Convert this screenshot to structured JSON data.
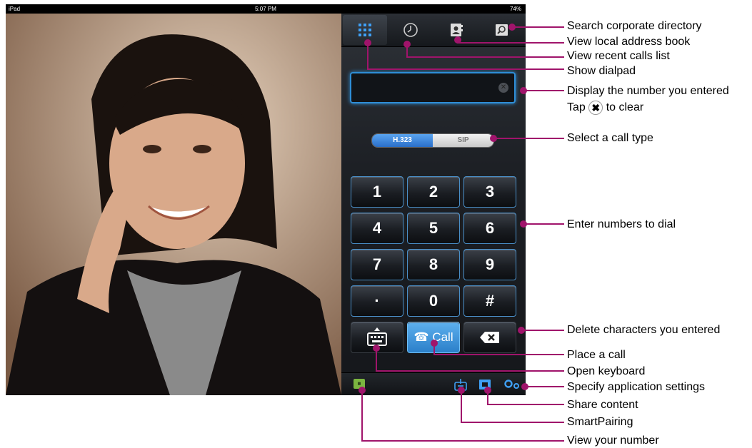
{
  "statusbar": {
    "device": "iPad",
    "time": "5:07 PM",
    "battery": "74%"
  },
  "tabs": [
    {
      "icon": "dialpad-icon"
    },
    {
      "icon": "recent-calls-icon"
    },
    {
      "icon": "address-book-icon"
    },
    {
      "icon": "search-directory-icon"
    }
  ],
  "call_type": {
    "options": [
      "H.323",
      "SIP"
    ],
    "selected": "H.323"
  },
  "keypad": [
    "1",
    "2",
    "3",
    "4",
    "5",
    "6",
    "7",
    "8",
    "9",
    "·",
    "0",
    "#"
  ],
  "call_button": {
    "label": "Call"
  },
  "annotations": {
    "search": "Search corporate directory",
    "address_book": "View local address book",
    "recent": "View recent calls list",
    "dialpad": "Show dialpad",
    "display1": "Display the number you entered",
    "display2_prefix": "Tap",
    "display2_suffix": "to clear",
    "call_type": "Select a call type",
    "enter": "Enter numbers to dial",
    "delete": "Delete characters you entered",
    "place": "Place a call",
    "keyboard": "Open keyboard",
    "settings": "Specify application settings",
    "share": "Share content",
    "pairing": "SmartPairing",
    "your_number": "View your number"
  },
  "colors": {
    "leader": "#a0146b",
    "accent": "#2f8ed6"
  }
}
